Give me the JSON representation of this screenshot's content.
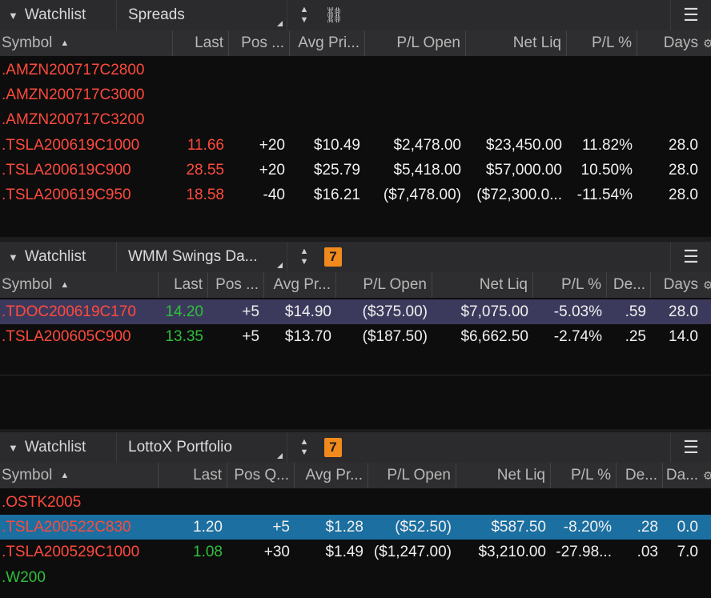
{
  "panels": [
    {
      "title": "Watchlist",
      "name": "Spreads",
      "control": "link",
      "badge": "",
      "columns": [
        "Symbol",
        "Last",
        "Pos ...",
        "Avg Pri...",
        "P/L Open",
        "Net Liq",
        "P/L %",
        "Days"
      ],
      "rows": [
        {
          "symbol": ".AMZN200717C2800",
          "stub": true
        },
        {
          "symbol": ".AMZN200717C3000",
          "stub": true
        },
        {
          "symbol": ".AMZN200717C3200",
          "stub": true
        },
        {
          "symbol": ".TSLA200619C1000",
          "last": "11.66",
          "pos": "+20",
          "avg": "$10.49",
          "plopen": "$2,478.00",
          "netliq": "$23,450.00",
          "plpct": "11.82%",
          "days": "28.0"
        },
        {
          "symbol": ".TSLA200619C900",
          "last": "28.55",
          "pos": "+20",
          "avg": "$25.79",
          "plopen": "$5,418.00",
          "netliq": "$57,000.00",
          "plpct": "10.50%",
          "days": "28.0"
        },
        {
          "symbol": ".TSLA200619C950",
          "last": "18.58",
          "pos": "-40",
          "avg": "$16.21",
          "plopen": "($7,478.00)",
          "netliq": "($72,300.0...",
          "plpct": "-11.54%",
          "days": "28.0"
        }
      ]
    },
    {
      "title": "Watchlist",
      "name": "WMM Swings Da...",
      "control": "badge",
      "badge": "7",
      "columns": [
        "Symbol",
        "Last",
        "Pos ...",
        "Avg Pr...",
        "P/L Open",
        "Net Liq",
        "P/L %",
        "De...",
        "Days"
      ],
      "rows": [
        {
          "symbol": ".TDOC200619C170",
          "last": "14.20",
          "pos": "+5",
          "avg": "$14.90",
          "plopen": "($375.00)",
          "netliq": "$7,075.00",
          "plpct": "-5.03%",
          "delta": ".59",
          "days": "28.0"
        },
        {
          "symbol": ".TSLA200605C900",
          "last": "13.35",
          "pos": "+5",
          "avg": "$13.70",
          "plopen": "($187.50)",
          "netliq": "$6,662.50",
          "plpct": "-2.74%",
          "delta": ".25",
          "days": "14.0"
        }
      ]
    },
    {
      "title": "Watchlist",
      "name": "LottoX Portfolio",
      "control": "badge",
      "badge": "7",
      "columns": [
        "Symbol",
        "Last",
        "Pos Q...",
        "Avg Pr...",
        "P/L Open",
        "Net Liq",
        "P/L %",
        "De...",
        "Da..."
      ],
      "rows": [
        {
          "symbol": ".OSTK2005",
          "stub": true
        },
        {
          "symbol": ".TSLA200522C830",
          "last": "1.20",
          "pos": "+5",
          "avg": "$1.28",
          "plopen": "($52.50)",
          "netliq": "$587.50",
          "plpct": "-8.20%",
          "delta": ".28",
          "days": "0.0"
        },
        {
          "symbol": ".TSLA200529C1000",
          "last": "1.08",
          "pos": "+30",
          "avg": "$1.49",
          "plopen": "($1,247.00)",
          "netliq": "$3,210.00",
          "plpct": "-27.98...",
          "delta": ".03",
          "days": "7.0"
        },
        {
          "symbol": ".W200",
          "stub": true
        }
      ]
    }
  ],
  "colors": {
    "loss": "#ff4a3d",
    "gain": "#2fbf3c",
    "selected_purple": "#3c3a5c",
    "selected_blue": "#1b6fa1",
    "badge": "#f08a1c"
  },
  "icons": {
    "collapse": "chevron-down-icon",
    "sort": "sort-up-down-icon",
    "link": "link-icon",
    "menu": "hamburger-menu-icon",
    "settings": "gear-icon"
  }
}
